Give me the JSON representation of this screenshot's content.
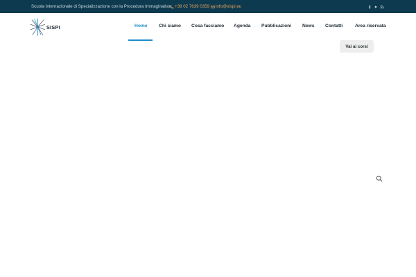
{
  "topbar": {
    "tagline": "Scuola Internazionale di Specializzazione con la Procedura Immaginativa",
    "phone": "+39 02 7639 0359",
    "email": "info@sispi.eu",
    "social": [
      "facebook-icon",
      "youtube-icon",
      "rss-icon"
    ]
  },
  "header": {
    "logo_text": "SISPI",
    "nav": [
      {
        "label": "Home",
        "active": true
      },
      {
        "label": "Chi siamo"
      },
      {
        "label": "Cosa facciamo"
      },
      {
        "label": "Agenda"
      },
      {
        "label": "Pubblicazioni"
      },
      {
        "label": "News"
      },
      {
        "label": "Contatti"
      },
      {
        "label": "Area riservata"
      }
    ],
    "cta_label": "Vai ai corsi"
  },
  "icons": {
    "search": "search-icon"
  },
  "colors": {
    "topbar_bg": "#0e3a4f",
    "accent": "#1e8dc8",
    "contact_link": "#e0a15a",
    "button_bg": "#eeeeee"
  }
}
